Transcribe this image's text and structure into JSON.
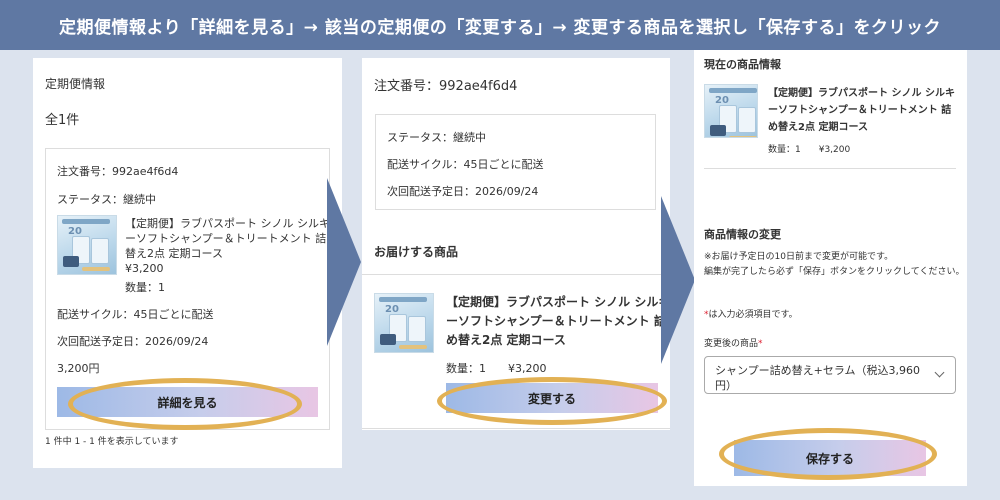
{
  "banner": {
    "text": "定期便情報より「詳細を見る」→ 該当の定期便の「変更する」→ 変更する商品を選択し「保存する」をクリック"
  },
  "panel1": {
    "title": "定期便情報",
    "count_label": "全1件",
    "order_number": "注文番号：992ae4f6d4",
    "status": "ステータス：継続中",
    "product_name_line1": "【定期便】ラブパスポート シノル シルキ",
    "product_name_line2": "ーソフトシャンプー＆トリートメント 詰め",
    "product_name_line3": "替え2点 定期コース",
    "price": "¥3,200",
    "quantity": "数量：1",
    "delivery_cycle": "配送サイクル：45日ごとに配送",
    "next_delivery": "次回配送予定日：2026/09/24",
    "total": "3,200円",
    "details_button": "詳細を見る",
    "pagination": "1 件中 1 - 1 件を表示しています"
  },
  "panel2": {
    "order_number": "注文番号：992ae4f6d4",
    "status": "ステータス：継続中",
    "delivery_cycle": "配送サイクル：45日ごとに配送",
    "next_delivery": "次回配送予定日：2026/09/24",
    "section_title": "お届けする商品",
    "product_name_line1": "【定期便】ラブパスポート シノル シルキ",
    "product_name_line2": "ーソフトシャンプー＆トリートメント 詰",
    "product_name_line3": "め替え2点 定期コース",
    "quantity_price": "数量：1　　¥3,200",
    "change_button": "変更する"
  },
  "panel3": {
    "current_title": "現在の商品情報",
    "product_name_line1": "【定期便】ラブパスポート シノル シルキ",
    "product_name_line2": "ーソフトシャンプー＆トリートメント 詰",
    "product_name_line3": "め替え2点 定期コース",
    "quantity_price": "数量：1　　¥3,200",
    "change_title": "商品情報の変更",
    "note1": "※お届け予定日の10日前まで変更が可能です。",
    "note2": "編集が完了したら必ず「保存」ボタンをクリックしてください。",
    "required_mark": "*",
    "required_note": "は入力必須項目です。",
    "select_label": "変更後の商品",
    "select_value": "シャンプー詰め替え+セラム（税込3,960円）",
    "save_button": "保存する"
  },
  "thumb": {
    "badge": "20"
  },
  "colors": {
    "banner": "#5f78a3",
    "highlight_ring": "#e2b154",
    "background": "#dce3ee"
  }
}
